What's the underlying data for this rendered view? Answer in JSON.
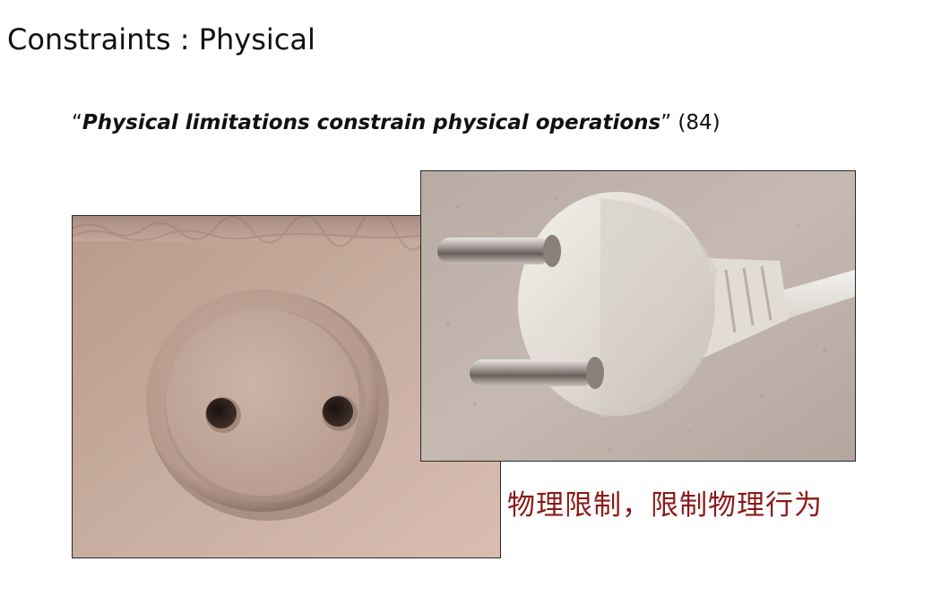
{
  "slide": {
    "title": "Constraints : Physical",
    "quote": {
      "open_mark": "“",
      "emphasis": "Physical limitations constrain physical operations",
      "close_mark": "”",
      "citation": " (84)"
    },
    "caption_cn": "物理限制，限制物理行为"
  },
  "images": {
    "socket": "two-hole-wall-socket",
    "plug": "two-pin-plug"
  },
  "colors": {
    "caption": "#8b1a1a",
    "text": "#111111"
  }
}
